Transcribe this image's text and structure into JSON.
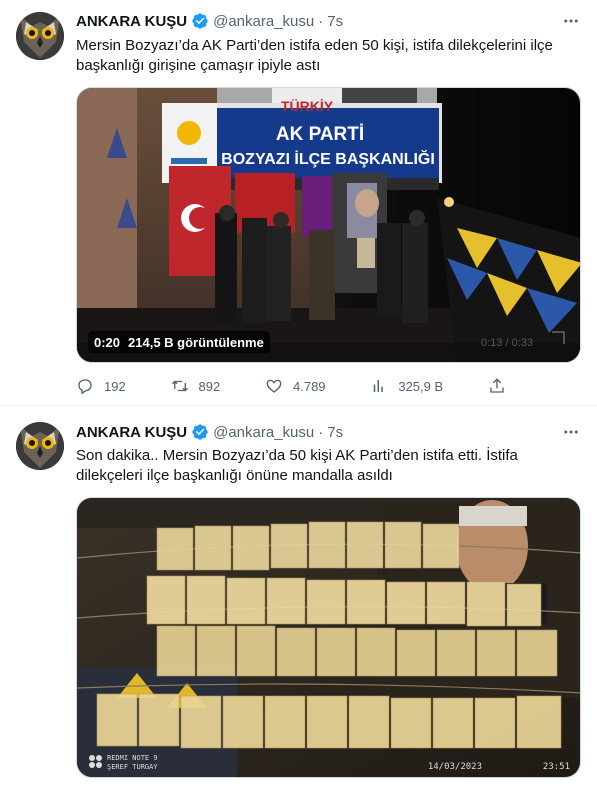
{
  "tweets": [
    {
      "display_name": "ANKARA KUŞU",
      "handle": "@ankara_kusu",
      "separator": "·",
      "time": "7s",
      "text_line1": "Mersin Bozyazı’da AK Parti’den istifa eden 50 kişi, istifa dilekçelerini ilçe",
      "text_line2": "başkanlığı girişine çamaşır ipiyle astı",
      "media": {
        "type": "video",
        "duration": "0:20",
        "views": "214,5 B görüntülenme",
        "sign_line1": "AK PARTİ",
        "sign_line2": "BOZYAZI İLÇE BAŞKANLIĞI",
        "banner": "TÜRKİY",
        "watermark": "0:13 / 0:33"
      },
      "stats": {
        "replies": "192",
        "retweets": "892",
        "likes": "4.789",
        "views": "325,9 B"
      }
    },
    {
      "display_name": "ANKARA KUŞU",
      "handle": "@ankara_kusu",
      "separator": "·",
      "time": "7s",
      "text_line1": "Son dakika.. Mersin Bozyazı’da 50 kişi AK Parti’den istifa etti. İstifa",
      "text_line2": "dilekçeleri ilçe başkanlığı önüne mandalla asıldı",
      "media": {
        "type": "photo",
        "camera_line1": "REDMI NOTE 9",
        "camera_line2": "ŞEREF TURGAY",
        "date": "14/03/2023",
        "clock": "23:51"
      }
    }
  ],
  "colors": {
    "verified": "#1d9bf0",
    "text": "#0f1419",
    "muted": "#536471",
    "divider": "#eff3f4"
  },
  "icons": [
    "verified-badge-icon",
    "more-icon",
    "reply-icon",
    "retweet-icon",
    "like-icon",
    "views-icon",
    "share-icon"
  ]
}
